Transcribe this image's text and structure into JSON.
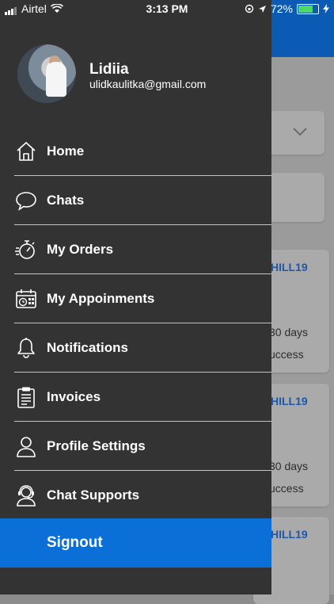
{
  "status_bar": {
    "carrier": "Airtel",
    "time": "3:13 PM",
    "battery": "72%"
  },
  "drawer": {
    "user": {
      "name": "Lidiia",
      "email": "ulidkaulitka@gmail.com"
    },
    "items": [
      {
        "label": "Home",
        "icon": "home-icon"
      },
      {
        "label": "Chats",
        "icon": "chat-bubble-icon"
      },
      {
        "label": "My Orders",
        "icon": "stopwatch-icon"
      },
      {
        "label": "My Appoinments",
        "icon": "calendar-clock-icon"
      },
      {
        "label": "Notifications",
        "icon": "bell-icon"
      },
      {
        "label": "Invoices",
        "icon": "clipboard-icon"
      },
      {
        "label": "Profile Settings",
        "icon": "user-icon"
      },
      {
        "label": "Chat Supports",
        "icon": "support-agent-icon"
      }
    ],
    "signout_label": "Signout"
  },
  "background": {
    "cards": [
      {
        "code": "HILL19",
        "line1": "30 days",
        "line2": "uccess"
      },
      {
        "code": "HILL19",
        "line1": "30 days",
        "line2": "uccess"
      },
      {
        "code": "HILL19"
      }
    ]
  },
  "colors": {
    "drawer_bg": "#333333",
    "signout_bg": "#0b6fd8",
    "header_bg": "#0b5bb4"
  }
}
